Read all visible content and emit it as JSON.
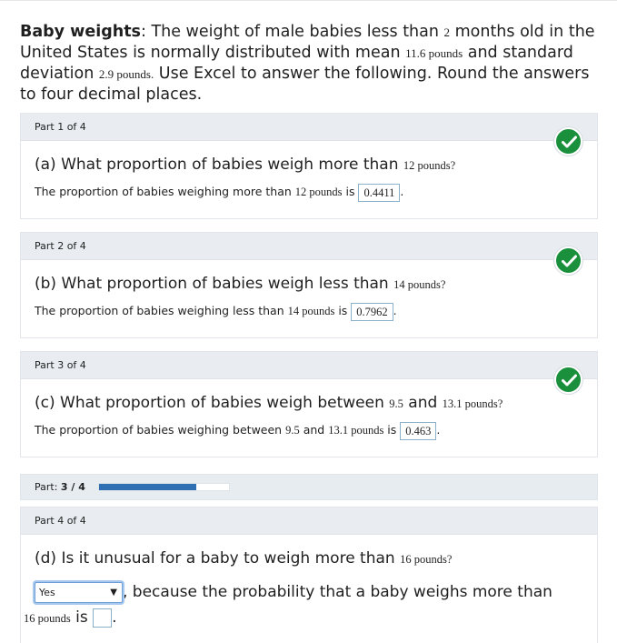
{
  "intro": {
    "title_bold": "Baby weights",
    "text_1": ": The weight of male babies less than ",
    "months_val": "2",
    "text_2": " months old in the United States is normally distributed with mean ",
    "mean_val": "11.6 pounds",
    "text_3": " and standard deviation ",
    "sd_val": "2.9 pounds.",
    "text_4": " Use Excel to answer the following. Round the answers to four decimal places."
  },
  "parts": [
    {
      "header": "Part 1 of 4",
      "question_pre": "(a) What proportion of babies weigh more than ",
      "question_val": "12 pounds?",
      "answer_pre": "The proportion of babies weighing more than ",
      "answer_val_text": "12 pounds",
      "answer_is": " is ",
      "answer": "0.4411",
      "answer_post": "."
    },
    {
      "header": "Part 2 of 4",
      "question_pre": "(b) What proportion of babies weigh less than ",
      "question_val": "14 pounds?",
      "answer_pre": "The proportion of babies weighing less than ",
      "answer_val_text": "14 pounds",
      "answer_is": " is ",
      "answer": "0.7962",
      "answer_post": "."
    },
    {
      "header": "Part 3 of 4",
      "question_pre": "(c) What proportion of babies weigh between ",
      "question_val_a": "9.5",
      "question_and": " and ",
      "question_val_b": "13.1 pounds?",
      "answer_pre": "The proportion of babies weighing between ",
      "answer_val_a": "9.5",
      "answer_and": " and ",
      "answer_val_b": "13.1 pounds",
      "answer_is": " is ",
      "answer": "0.463",
      "answer_post": "."
    }
  ],
  "progress": {
    "label": "Part: ",
    "value_text": "3 / 4",
    "fraction": 0.75
  },
  "part4": {
    "header": "Part 4 of 4",
    "question_pre": "(d) Is it unusual for a baby to weigh more than ",
    "question_val": "16 pounds?",
    "select_value": "Yes",
    "select_arrow": "▼",
    "reason_text": ", because the probability that a baby weighs more than",
    "line2_val": "16 pounds",
    "line2_is": " is ",
    "line2_post": ".",
    "answer_box": ""
  },
  "colors": {
    "check_green": "#1a8f3c",
    "progress_blue": "#2f6fb3",
    "panel_header_bg": "#e9edf1"
  },
  "icons": {
    "check": "check-circle-icon",
    "dropdown": "chevron-down-icon"
  }
}
